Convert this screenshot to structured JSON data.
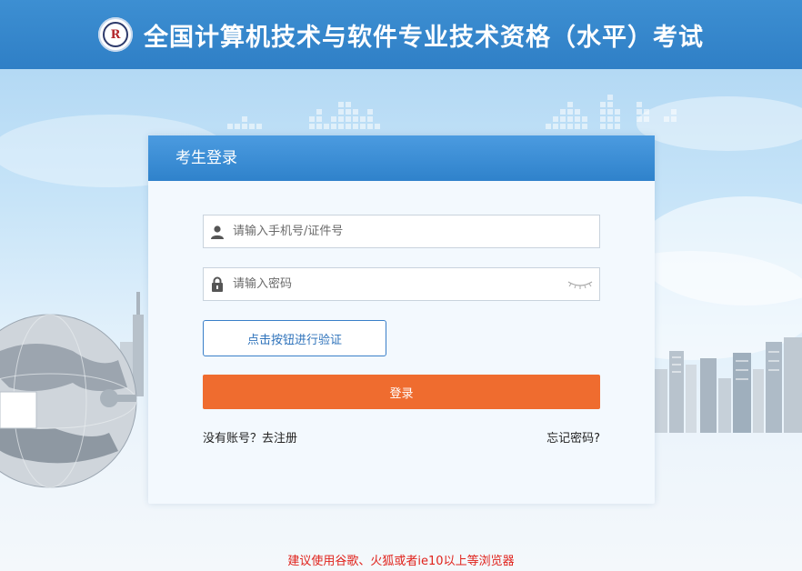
{
  "header": {
    "title": "全国计算机技术与软件专业技术资格（水平）考试",
    "logo_icon": "exam-logo-icon",
    "background_color": "#3388cc"
  },
  "login": {
    "panel_title": "考生登录",
    "username_placeholder": "请输入手机号/证件号",
    "username_value": "",
    "password_placeholder": "请输入密码",
    "password_value": "",
    "verify_button_label": "点击按钮进行验证",
    "login_button_label": "登录",
    "register_link": "没有账号？去注册",
    "forgot_link": "忘记密码?",
    "icons": {
      "user": "user-icon",
      "lock": "lock-icon",
      "eye": "eye-closed-icon"
    },
    "colors": {
      "login_button": "#ef6c2f",
      "panel_header": "#3b8bd5",
      "verify_border": "#3a7fc8"
    }
  },
  "footer": {
    "browser_tip": "建议使用谷歌、火狐或者ie10以上等浏览器",
    "tip_color": "#e0231c"
  }
}
